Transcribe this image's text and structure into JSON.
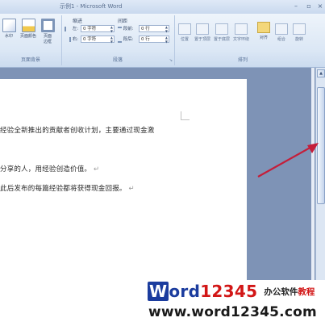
{
  "window": {
    "title": "示例1 - Microsoft Word"
  },
  "ribbon": {
    "background_group": {
      "label": "页面背景",
      "buttons": [
        {
          "label": "水印"
        },
        {
          "label": "页面颜色"
        },
        {
          "label": "页面\n边框"
        }
      ]
    },
    "paragraph_group": {
      "label": "段落",
      "indent": {
        "title": "缩进",
        "left_label": "左:",
        "left_value": "0 字符",
        "right_label": "右:",
        "right_value": "0 字符"
      },
      "spacing": {
        "title": "间距",
        "before_label": "段前:",
        "before_value": "0 行",
        "after_label": "段后:",
        "after_value": "0 行"
      }
    },
    "arrange_group": {
      "label": "排列",
      "buttons": [
        {
          "label": "位置"
        },
        {
          "label": "置于顶层"
        },
        {
          "label": "置于底层"
        },
        {
          "label": "文字环绕"
        },
        {
          "label": "对齐"
        },
        {
          "label": "组合"
        },
        {
          "label": "旋转"
        }
      ]
    }
  },
  "document": {
    "lines": [
      {
        "text": "经验全新推出的贡献者创收计划，主要通过现金激",
        "mark": ""
      },
      {
        "text": "分享的人，用经验创造价值。",
        "mark": "↵"
      },
      {
        "text": "此后发布的每篇经验都将获得现金回报。",
        "mark": "↵"
      }
    ]
  },
  "watermark": {
    "brand_w": "W",
    "brand_ord": "ord",
    "brand_num": "12345",
    "tag_1": "办公软件",
    "tag_2": "教程",
    "url": "www.word12345.com"
  },
  "colors": {
    "arrow": "#c41e3a",
    "brand_blue": "#1b3c9e",
    "brand_red": "#d21616"
  }
}
